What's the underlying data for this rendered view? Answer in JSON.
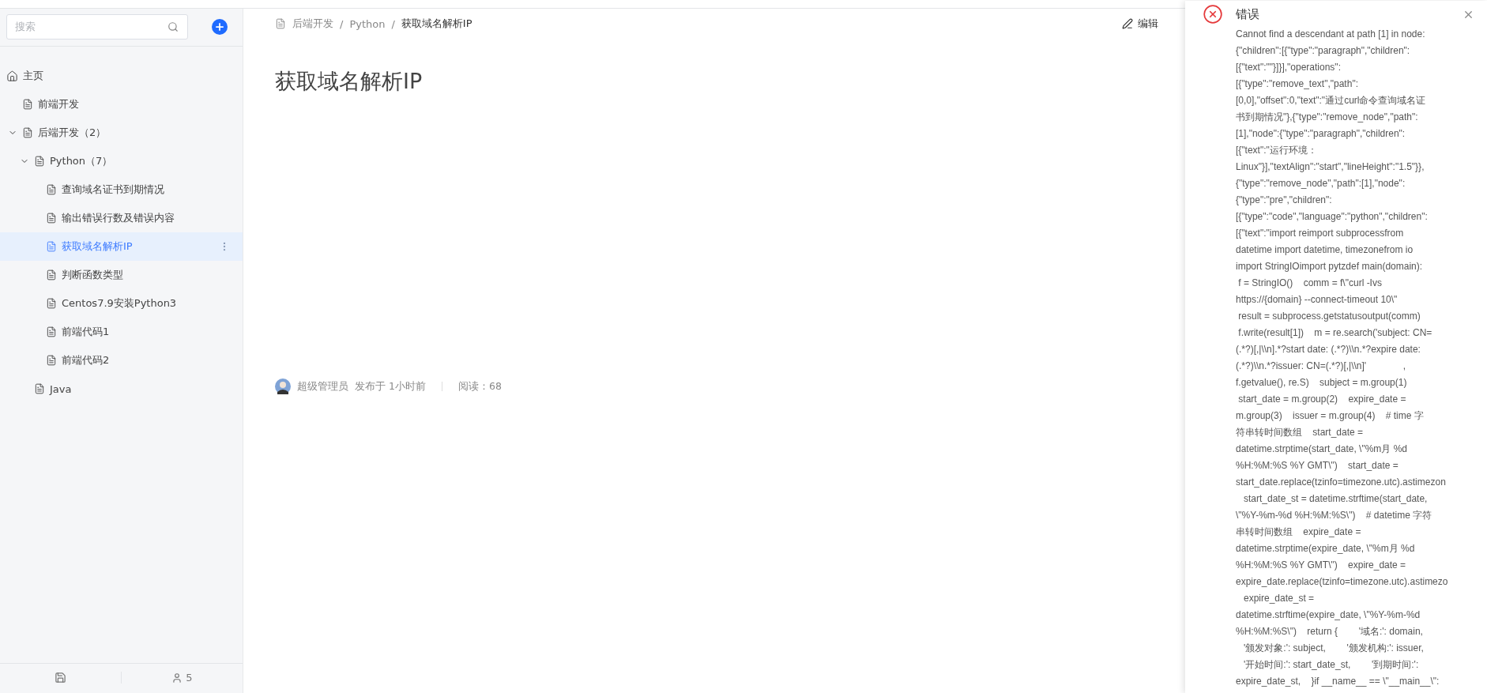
{
  "sidebar": {
    "search": {
      "placeholder": "搜索"
    },
    "home": {
      "label": "主页"
    },
    "tree": [
      {
        "label": "前端开发",
        "selected": false
      },
      {
        "label": "后端开发（2）",
        "selected": false,
        "expanded": true,
        "children": [
          {
            "label": "Python（7）",
            "selected": false,
            "expanded": true,
            "children": [
              {
                "label": "查询域名证书到期情况",
                "selected": false
              },
              {
                "label": "输出错误行数及错误内容",
                "selected": false
              },
              {
                "label": "获取域名解析IP",
                "selected": true
              },
              {
                "label": "判断函数类型",
                "selected": false
              },
              {
                "label": "Centos7.9安装Python3",
                "selected": false
              },
              {
                "label": "前端代码1",
                "selected": false
              },
              {
                "label": "前端代码2",
                "selected": false
              }
            ]
          },
          {
            "label": "Java",
            "selected": false
          }
        ]
      }
    ],
    "footer": {
      "members": "5"
    }
  },
  "breadcrumb": [
    "后端开发",
    "Python",
    "获取域名解析IP"
  ],
  "separator": "/",
  "edit_button": "编辑",
  "article": {
    "title": "获取域名解析IP",
    "author": "超级管理员",
    "published": "发布于 1小时前",
    "reads": "阅读：68"
  },
  "notification": {
    "title": "错误",
    "message": [
      "Cannot find a descendant at path [1] in node:",
      "{\"children\":[{\"type\":\"paragraph\",\"children\":",
      "[{\"text\":\"\"}]}],\"operations\":",
      "[{\"type\":\"remove_text\",\"path\":",
      "[0,0],\"offset\":0,\"text\":\"通过curl命令查询域名证",
      "书到期情况\"},{\"type\":\"remove_node\",\"path\":",
      "[1],\"node\":{\"type\":\"paragraph\",\"children\":",
      "[{\"text\":\"运行环境：",
      "Linux\"}],\"textAlign\":\"start\",\"lineHeight\":\"1.5\"}},",
      "{\"type\":\"remove_node\",\"path\":[1],\"node\":",
      "{\"type\":\"pre\",\"children\":",
      "[{\"type\":\"code\",\"language\":\"python\",\"children\":",
      "[{\"text\":\"import reimport subprocessfrom",
      "datetime import datetime, timezonefrom io",
      "import StringIOimport pytzdef main(domain):",
      " f = StringIO()    comm = f\\\"curl -Ivs",
      "https://{domain} --connect-timeout 10\\\"",
      " result = subprocess.getstatusoutput(comm)",
      " f.write(result[1])    m = re.search('subject: CN=",
      "(.*?)[,|\\\\n].*?start date: (.*?)\\\\n.*?expire date:",
      "(.*?)\\\\n.*?issuer: CN=(.*?)[,|\\\\n]'              ,",
      "f.getvalue(), re.S)    subject = m.group(1)",
      " start_date = m.group(2)    expire_date =",
      "m.group(3)    issuer = m.group(4)    # time 字",
      "符串转时间数组    start_date =",
      "datetime.strptime(start_date, \\\"%m月 %d",
      "%H:%M:%S %Y GMT\\\")    start_date =",
      "start_date.replace(tzinfo=timezone.utc).astimezon",
      "   start_date_st = datetime.strftime(start_date,",
      "\\\"%Y-%m-%d %H:%M:%S\\\")    # datetime 字符",
      "串转时间数组    expire_date =",
      "datetime.strptime(expire_date, \\\"%m月 %d",
      "%H:%M:%S %Y GMT\\\")    expire_date =",
      "expire_date.replace(tzinfo=timezone.utc).astimezo",
      "   expire_date_st =",
      "datetime.strftime(expire_date, \\\"%Y-%m-%d",
      "%H:%M:%S\\\")    return {        '域名:': domain,",
      "   '颁发对象:': subject,        '颁发机构:': issuer,",
      "   '开始时间:': start_date_st,        '到期时间:':",
      "expire_date_st,    }if __name__ == \\\"__main__\\\":"
    ]
  }
}
